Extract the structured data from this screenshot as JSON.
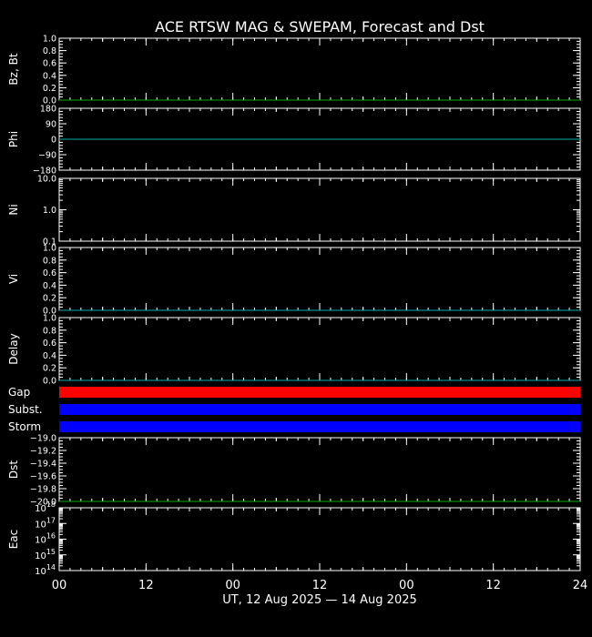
{
  "chart_data": {
    "type": "line",
    "title": "ACE RTSW MAG & SWEPAM, Forecast and Dst",
    "xlabel": "UT, 12 Aug 2025 — 14 Aug 2025",
    "x_tick_labels": [
      "00",
      "12",
      "00",
      "12",
      "00",
      "12",
      "24"
    ],
    "colors": {
      "axes": "#ffffff",
      "background": "#000000",
      "gap_bar": "#ff0000",
      "subst_bar": "#0000ff",
      "storm_bar": "#0000ff",
      "bz_line": "#00aa00",
      "phi_line": "#00aaaa",
      "vi_line": "#00aaaa",
      "delay_line": "#00aaaa",
      "dst_line": "#00aa00"
    },
    "panels": [
      {
        "key": "bzbt",
        "ylabel": "Bz, Bt",
        "scale": "linear",
        "ylim": [
          0,
          1.0
        ],
        "ticks": [
          {
            "v": 0.0,
            "label": "0.0"
          },
          {
            "v": 0.2,
            "label": "0.2"
          },
          {
            "v": 0.4,
            "label": "0.4"
          },
          {
            "v": 0.6,
            "label": "0.6"
          },
          {
            "v": 0.8,
            "label": "0.8"
          },
          {
            "v": 1.0,
            "label": "1.0"
          }
        ],
        "line_value": 0,
        "line_color": "#00aa00"
      },
      {
        "key": "phi",
        "ylabel": "Phi",
        "scale": "linear",
        "ylim": [
          -180,
          180
        ],
        "ticks": [
          {
            "v": -180,
            "label": "−180"
          },
          {
            "v": -90,
            "label": "−90"
          },
          {
            "v": 0,
            "label": "0"
          },
          {
            "v": 90,
            "label": "90"
          },
          {
            "v": 180,
            "label": "180"
          }
        ],
        "line_value": 0,
        "line_color": "#00aaaa"
      },
      {
        "key": "ni",
        "ylabel": "Ni",
        "scale": "log",
        "ylim": [
          0.1,
          10.0
        ],
        "ticks": [
          {
            "v": 0.1,
            "label": "0.1"
          },
          {
            "v": 1.0,
            "label": "1.0"
          },
          {
            "v": 10.0,
            "label": "10.0"
          }
        ]
      },
      {
        "key": "vi",
        "ylabel": "Vi",
        "scale": "linear",
        "ylim": [
          0,
          1.0
        ],
        "ticks": [
          {
            "v": 0.0,
            "label": "0.0"
          },
          {
            "v": 0.2,
            "label": "0.2"
          },
          {
            "v": 0.4,
            "label": "0.4"
          },
          {
            "v": 0.6,
            "label": "0.6"
          },
          {
            "v": 0.8,
            "label": "0.8"
          },
          {
            "v": 1.0,
            "label": "1.0"
          }
        ],
        "line_value": 0,
        "line_color": "#00aaaa"
      },
      {
        "key": "delay",
        "ylabel": "Delay",
        "scale": "linear",
        "ylim": [
          0,
          1.0
        ],
        "ticks": [
          {
            "v": 0.0,
            "label": "0.0"
          },
          {
            "v": 0.2,
            "label": "0.2"
          },
          {
            "v": 0.4,
            "label": "0.4"
          },
          {
            "v": 0.6,
            "label": "0.6"
          },
          {
            "v": 0.8,
            "label": "0.8"
          },
          {
            "v": 1.0,
            "label": "1.0"
          }
        ],
        "line_value": 0,
        "line_color": "#00aaaa"
      }
    ],
    "status_bars": [
      {
        "label": "Gap",
        "color": "#ff0000"
      },
      {
        "label": "Subst.",
        "color": "#0000ff"
      },
      {
        "label": "Storm",
        "color": "#0000ff"
      }
    ],
    "lower_panels": [
      {
        "key": "dst",
        "ylabel": "Dst",
        "scale": "linear",
        "ylim": [
          -20.0,
          -19.0
        ],
        "ticks": [
          {
            "v": -20.0,
            "label": "−20.0"
          },
          {
            "v": -19.8,
            "label": "−19.8"
          },
          {
            "v": -19.6,
            "label": "−19.6"
          },
          {
            "v": -19.4,
            "label": "−19.4"
          },
          {
            "v": -19.2,
            "label": "−19.2"
          },
          {
            "v": -19.0,
            "label": "−19.0"
          }
        ],
        "line_value": -20.0,
        "line_color": "#00aa00"
      },
      {
        "key": "eac",
        "ylabel": "Eac",
        "scale": "log",
        "ylim": [
          100000000000000.0,
          1e+18
        ],
        "ticks": [
          {
            "v": 100000000000000.0,
            "base": "10",
            "exp": "14"
          },
          {
            "v": 1000000000000000.0,
            "base": "10",
            "exp": "15"
          },
          {
            "v": 1e+16,
            "base": "10",
            "exp": "16"
          },
          {
            "v": 1e+17,
            "base": "10",
            "exp": "17"
          },
          {
            "v": 1e+18,
            "base": "10",
            "exp": "18"
          }
        ]
      }
    ]
  }
}
